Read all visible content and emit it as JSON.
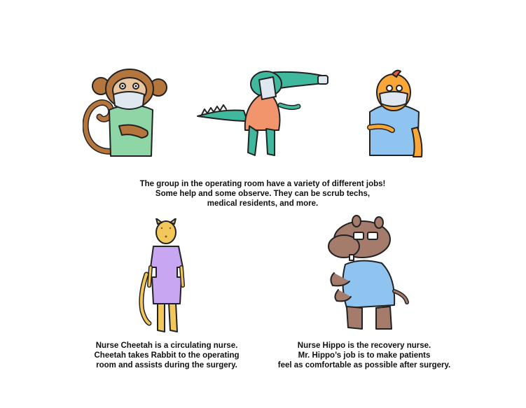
{
  "intro": {
    "lines": [
      "The group in the operating room have a variety of different jobs!",
      "Some help and some observe.  They can be scrub techs,",
      "medical residents, and more."
    ]
  },
  "cheetah": {
    "lines": [
      "Nurse Cheetah is a circulating nurse.",
      "Cheetah takes Rabbit to the operating",
      "room and assists during the surgery."
    ]
  },
  "hippo": {
    "lines": [
      "Nurse Hippo is the recovery nurse.",
      "Mr. Hippo’s job is to make patients",
      "feel as comfortable as possible after surgery."
    ]
  },
  "colors": {
    "monkey": "#b5763e",
    "scrubs_green": "#8fd6a6",
    "alligator": "#3fb89e",
    "alligator_shirt": "#f2956c",
    "scrubs_blue": "#8fc3f0",
    "duck": "#f7a637",
    "cheetah": "#f2c85a",
    "scrubs_purple": "#c9a6f2",
    "hippo": "#a57b6c",
    "mask": "#dfe8f0"
  }
}
